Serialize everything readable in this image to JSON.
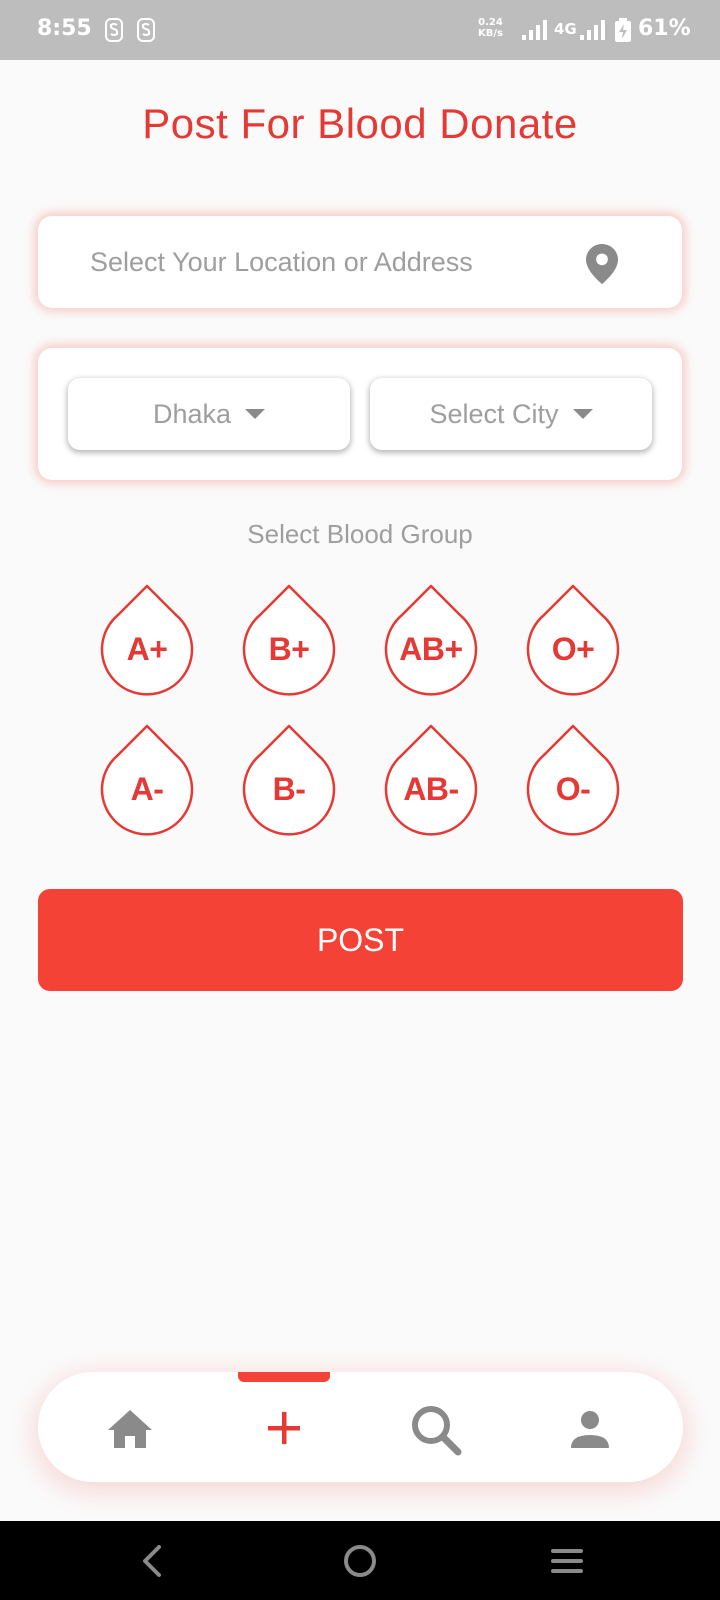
{
  "status_bar": {
    "time": "8:55",
    "speed_value": "0.24",
    "speed_unit": "KB/s",
    "network": "4G",
    "battery_percent": "61%",
    "icons": [
      "sim-s-icon",
      "sim-s-icon",
      "signal-icon",
      "signal-icon",
      "battery-charging-icon"
    ]
  },
  "page": {
    "title": "Post For Blood Donate"
  },
  "location": {
    "placeholder": "Select Your Location or Address",
    "icon": "location-pin-icon"
  },
  "selects": {
    "division": "Dhaka",
    "city": "Select City"
  },
  "blood_group": {
    "label": "Select Blood Group",
    "groups": [
      "A+",
      "B+",
      "AB+",
      "O+",
      "A-",
      "B-",
      "AB-",
      "O-"
    ]
  },
  "post_button": {
    "label": "POST"
  },
  "bottom_nav": {
    "items": [
      "home-icon",
      "add-icon",
      "search-icon",
      "profile-icon"
    ],
    "active": "add-icon"
  },
  "system_nav": {
    "items": [
      "back-icon",
      "home-circle-icon",
      "menu-icon"
    ]
  },
  "colors": {
    "accent": "#f44336",
    "title": "#e53935",
    "muted_text": "#9e9e9e",
    "status_bar": "#bdbdbd",
    "background": "#fafafa"
  }
}
